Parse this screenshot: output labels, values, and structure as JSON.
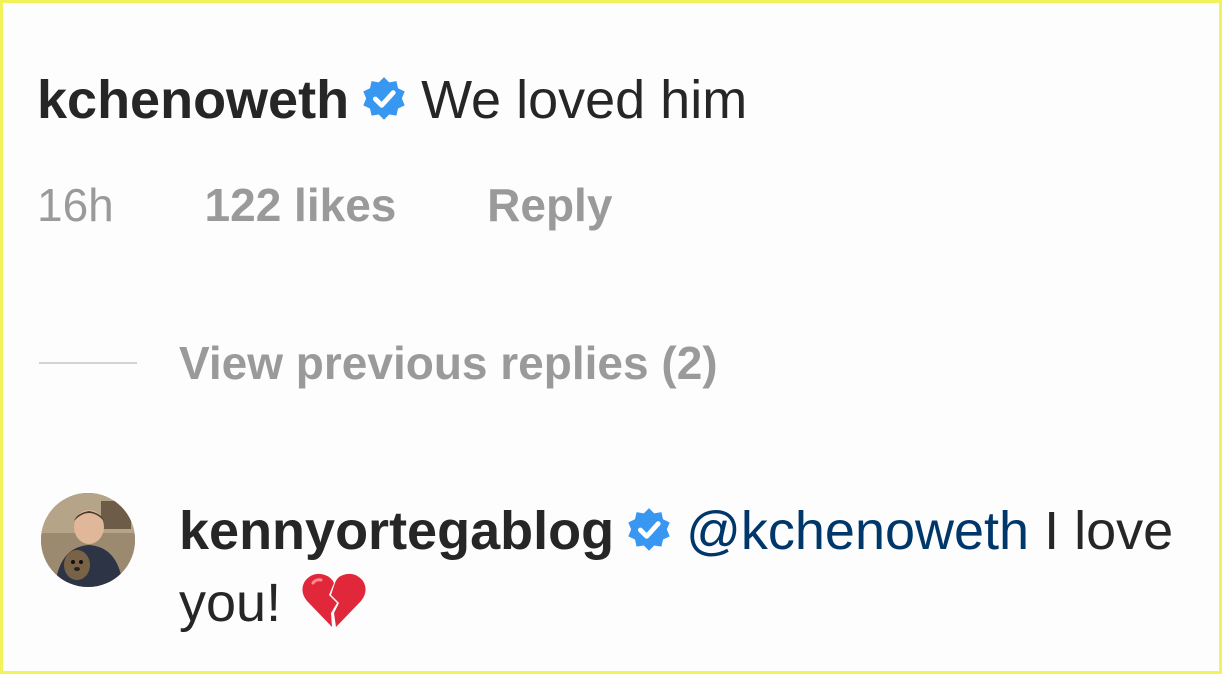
{
  "comment": {
    "username": "kchenoweth",
    "text": "We loved him",
    "time": "16h",
    "likes": "122 likes",
    "reply_label": "Reply"
  },
  "replies": {
    "view_previous_label": "View previous replies (2)"
  },
  "reply": {
    "username": "kennyortegablog",
    "mention": "@kchenoweth",
    "text": "I love you!",
    "emoji": "broken-heart"
  },
  "colors": {
    "verified": "#3897f0",
    "mention": "#00376b",
    "muted": "#9a9a9a",
    "frame_border": "#f0f35a"
  }
}
